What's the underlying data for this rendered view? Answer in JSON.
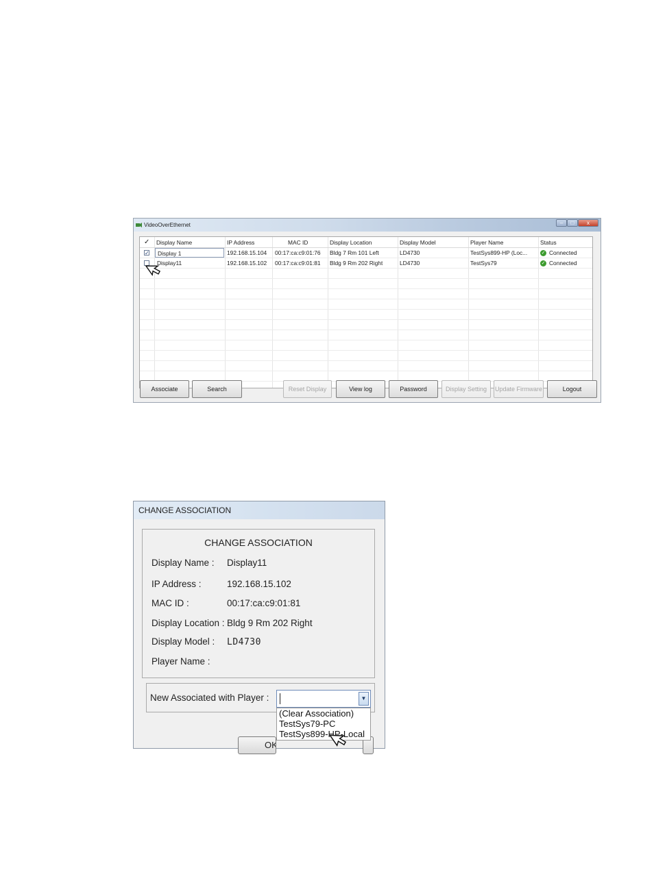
{
  "main_window": {
    "title": "VideoOverEthernet",
    "controls": {
      "minimize": "–",
      "maximize": "□",
      "close": "x"
    },
    "columns": [
      "✓",
      "Display Name",
      "IP Address",
      "MAC ID",
      "Display Location",
      "Display Model",
      "Player Name",
      "Status"
    ],
    "rows": [
      {
        "checked": "✓",
        "name": "Display 1",
        "ip": "192.168.15.104",
        "mac": "00:17:ca:c9:01:76",
        "location": "Bldg 7 Rm 101 Left",
        "model": "LD4730",
        "player": "TestSys899-HP (Loc...",
        "status": "Connected",
        "status_icon": "check-icon"
      },
      {
        "checked": "",
        "name": "Display11",
        "ip": "192.168.15.102",
        "mac": "00:17:ca:c9:01:81",
        "location": "Bldg 9 Rm 202 Right",
        "model": "LD4730",
        "player": "TestSys79",
        "status": "Connected",
        "status_icon": "check-icon"
      }
    ],
    "buttons": {
      "associate": "Associate",
      "search": "Search",
      "reset_display": "Reset Display",
      "view_log": "View log",
      "password": "Password",
      "display_setting": "Display Setting",
      "update_firmware": "Update Firmware",
      "logout": "Logout"
    },
    "cursor_icon": "arrow-cursor-icon"
  },
  "dialog": {
    "title": "CHANGE ASSOCIATION",
    "heading": "CHANGE ASSOCIATION",
    "fields": [
      {
        "label": "Display Name :",
        "value": "Display11"
      },
      {
        "label": "IP Address :",
        "value": "192.168.15.102"
      },
      {
        "label": "MAC ID :",
        "value": "00:17:ca:c9:01:81"
      },
      {
        "label": "Display Location :",
        "value": "Bldg 9 Rm 202 Right"
      },
      {
        "label": "Display Model :",
        "value": "LD4730"
      },
      {
        "label": "Player Name :",
        "value": ""
      }
    ],
    "new_player_label": "New Associated with Player :",
    "combo_value": "",
    "combo_arrow": "▼",
    "options": [
      "(Clear Association)",
      "TestSys79-PC",
      "TestSys899-HP-Local"
    ],
    "ok_button": "OK",
    "cursor_icon": "arrow-cursor-icon"
  },
  "colors": {
    "status_ok": "#3c9b2e",
    "selection_border": "#8b9bb6",
    "disabled_text": "#a5a5a5"
  }
}
